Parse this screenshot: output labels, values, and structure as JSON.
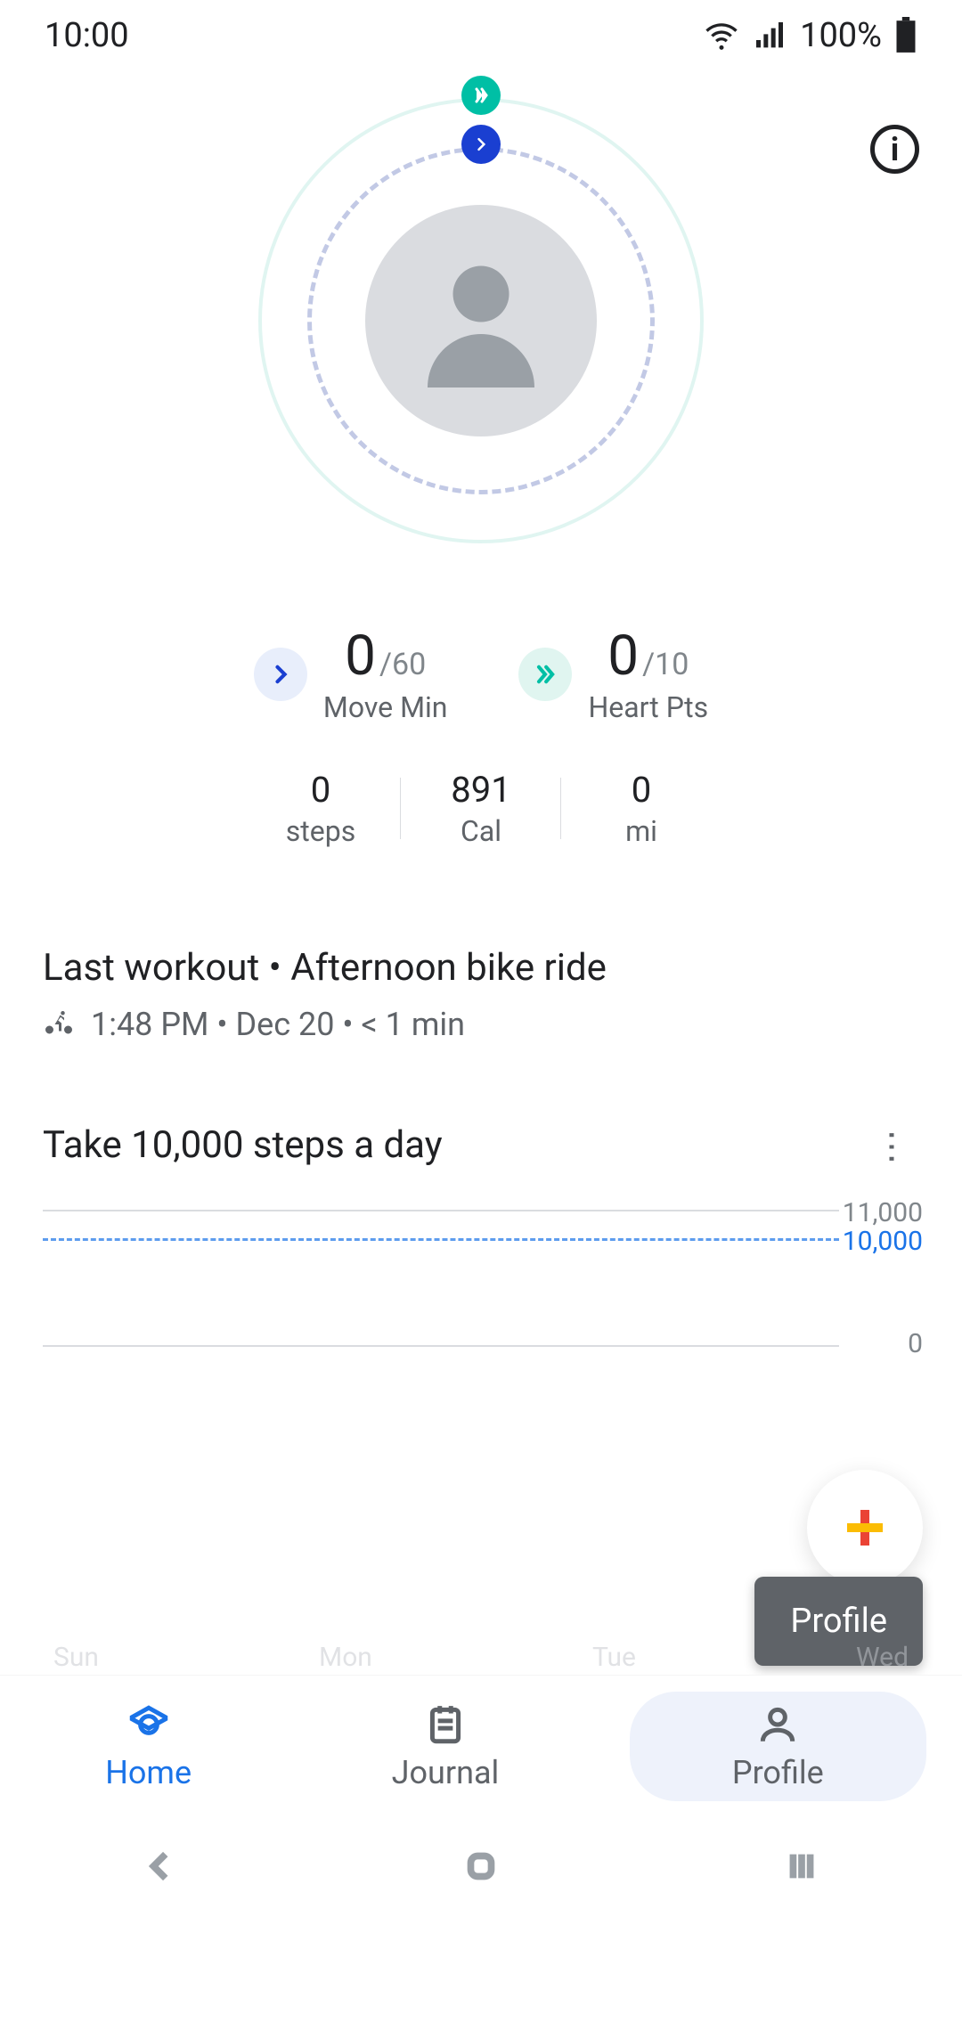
{
  "status": {
    "time": "10:00",
    "battery": "100%"
  },
  "rings": {
    "move_min": {
      "value": "0",
      "goal": "/60",
      "label": "Move Min"
    },
    "heart_pts": {
      "value": "0",
      "goal": "/10",
      "label": "Heart Pts"
    }
  },
  "stats": {
    "steps": {
      "value": "0",
      "label": "steps"
    },
    "cal": {
      "value": "891",
      "label": "Cal"
    },
    "mi": {
      "value": "0",
      "label": "mi"
    }
  },
  "last_workout": {
    "title": "Last workout • Afternoon bike ride",
    "subtitle": "1:48 PM • Dec 20 • < 1 min"
  },
  "goal": {
    "title": "Take 10,000 steps a day",
    "axis_top": "11,000",
    "axis_goal": "10,000",
    "axis_mid": "0"
  },
  "tooltip": "Profile",
  "nav": {
    "home": "Home",
    "journal": "Journal",
    "profile": "Profile"
  },
  "days": [
    "Sun",
    "Mon",
    "Tue",
    "Wed"
  ]
}
